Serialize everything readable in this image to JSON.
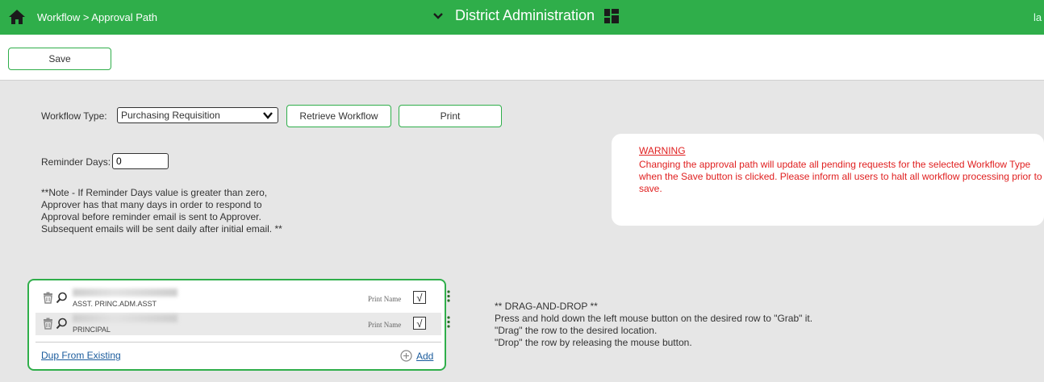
{
  "header": {
    "breadcrumb": "Workflow > Approval Path",
    "district_title": "District Administration",
    "cut_text": "la"
  },
  "toolbar": {
    "save_label": "Save"
  },
  "form": {
    "workflow_type_label": "Workflow Type:",
    "workflow_type_value": "Purchasing Requisition",
    "retrieve_label": "Retrieve Workflow",
    "print_label": "Print",
    "reminder_days_label": "Reminder Days:",
    "reminder_days_value": "0",
    "note_lines": [
      "**Note - If Reminder Days value is greater than zero,",
      "Approver has that many days in order to respond to",
      "Approval before reminder email is sent to Approver.",
      "Subsequent emails will be sent daily after initial email. **"
    ]
  },
  "warning": {
    "title": "WARNING",
    "text": "Changing the approval path will update all pending requests for the selected Workflow Type when the Save button is clicked. Please inform all users to halt all workflow processing prior to save."
  },
  "approvers": {
    "rows": [
      {
        "role": "ASST. PRINC.ADM.ASST",
        "print_name_label": "Print Name",
        "checked": "√"
      },
      {
        "role": "PRINCIPAL",
        "print_name_label": "Print Name",
        "checked": "√"
      }
    ],
    "dup_label": "Dup From Existing",
    "add_label": "Add"
  },
  "drag_drop": {
    "lines": [
      "** DRAG-AND-DROP **",
      "Press and hold down the left mouse button on the desired row to \"Grab\" it.",
      "\"Drag\" the row to the desired location.",
      "\"Drop\" the row by releasing the mouse button."
    ]
  },
  "colors": {
    "brand_green": "#2fae4a",
    "warning_red": "#e02020",
    "link_blue": "#1a5b9c"
  },
  "icons": [
    "home-icon",
    "chevron-down-icon",
    "grid-icon",
    "trash-icon",
    "search-icon",
    "kebab-menu-icon",
    "plus-circle-icon"
  ]
}
